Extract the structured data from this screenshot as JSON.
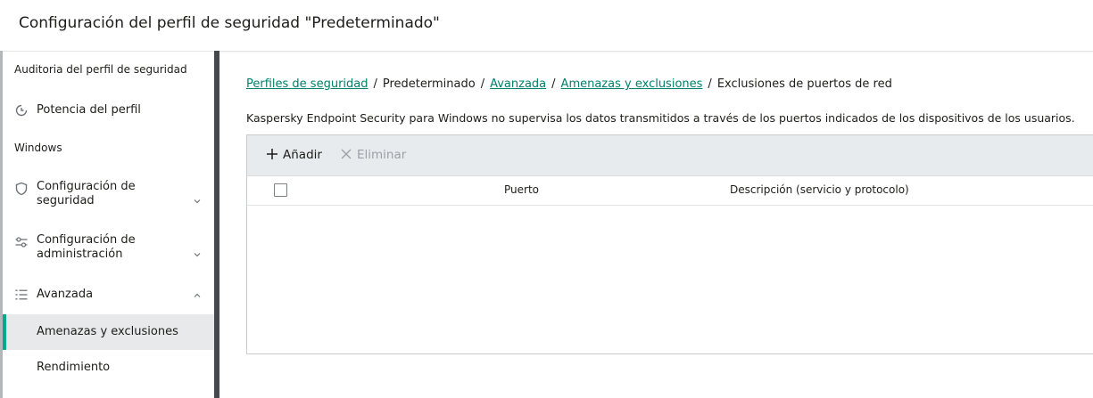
{
  "header": {
    "title": "Configuración del perfil de seguridad \"Predeterminado\""
  },
  "sidebar": {
    "section_audit": "Auditoria del perfil de seguridad",
    "profile_strength": "Potencia del perfil",
    "section_windows": "Windows",
    "security_config_line1": "Configuración de",
    "security_config_line2": "seguridad",
    "admin_config_line1": "Configuración de",
    "admin_config_line2": "administración",
    "advanced": "Avanzada",
    "threats_exclusions": "Amenazas y exclusiones",
    "performance": "Rendimiento",
    "active_item": "Amenazas y exclusiones",
    "accent_color": "#00a88e"
  },
  "breadcrumb": {
    "profiles": "Perfiles de seguridad",
    "sep": "/",
    "default": "Predeterminado",
    "advanced": "Avanzada",
    "threats": "Amenazas y exclusiones",
    "current": "Exclusiones de puertos de red"
  },
  "main": {
    "description": "Kaspersky Endpoint Security para Windows no supervisa los datos transmitidos a través de los puertos indicados de los dispositivos de los usuarios."
  },
  "toolbar": {
    "add_label": "Añadir",
    "delete_label": "Eliminar",
    "add_icon": "plus-icon",
    "delete_icon": "x-icon"
  },
  "table": {
    "columns": [
      "Puerto",
      "Descripción (servicio y protocolo)"
    ],
    "rows": []
  },
  "colors": {
    "link": "#00806c",
    "toolbar_bg": "#e7ebee",
    "disabled_text": "#9da1a5"
  }
}
